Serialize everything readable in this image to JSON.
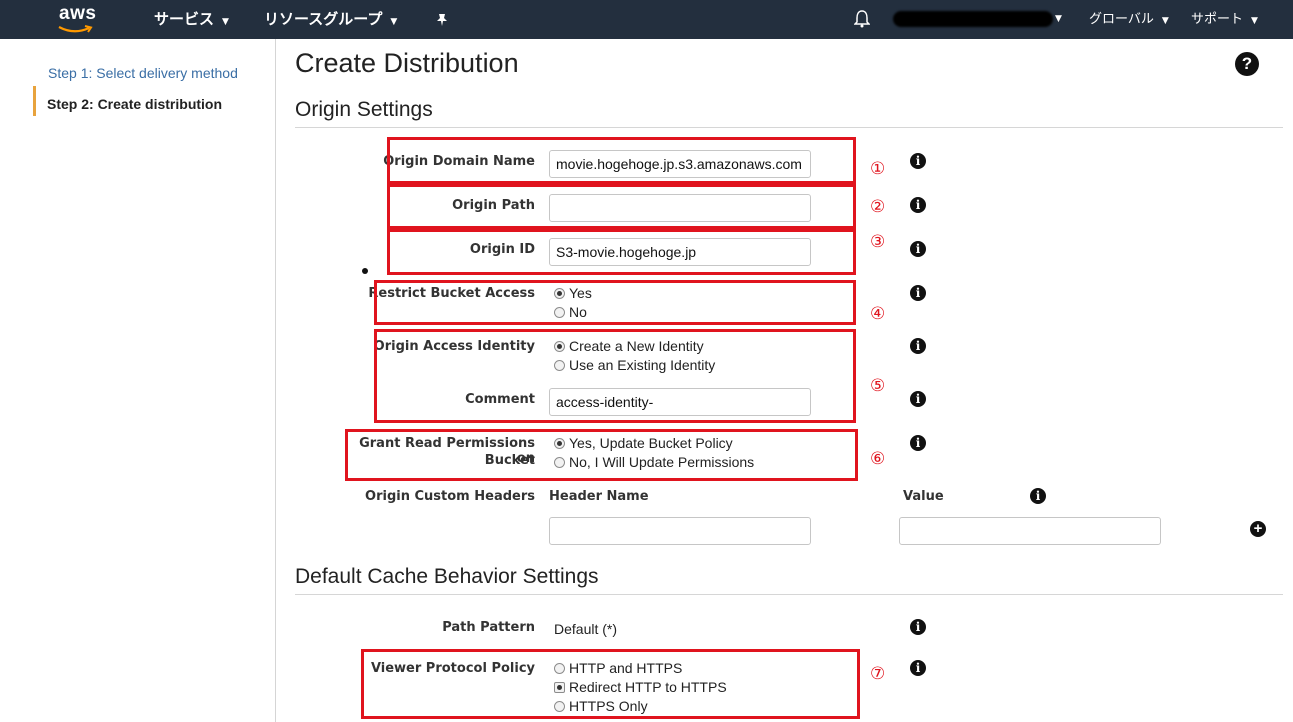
{
  "nav": {
    "logo_text": "aws",
    "services": "サービス",
    "resource_groups": "リソースグループ",
    "region": "グローバル",
    "support": "サポート"
  },
  "sidebar": {
    "step1": "Step 1: Select delivery method",
    "step2": "Step 2: Create distribution"
  },
  "page": {
    "title": "Create Distribution",
    "help_icon": "?",
    "origin_section": "Origin Settings",
    "cache_section": "Default Cache Behavior Settings"
  },
  "origin": {
    "domain_label": "Origin Domain Name",
    "domain_value": "movie.hogehoge.jp.s3.amazonaws.com",
    "path_label": "Origin Path",
    "path_value": "",
    "id_label": "Origin ID",
    "id_value": "S3-movie.hogehoge.jp",
    "restrict_label": "Restrict Bucket Access",
    "restrict_options": [
      "Yes",
      "No"
    ],
    "restrict_selected": "Yes",
    "oai_label": "Origin Access Identity",
    "oai_options": [
      "Create a New Identity",
      "Use an Existing Identity"
    ],
    "oai_selected": "Create a New Identity",
    "comment_label": "Comment",
    "comment_value": "access-identity-",
    "grant_label_1": "Grant Read Permissions on",
    "grant_label_2": "Bucket",
    "grant_options": [
      "Yes, Update Bucket Policy",
      "No, I Will Update Permissions"
    ],
    "grant_selected": "Yes, Update Bucket Policy",
    "custom_headers_label": "Origin Custom Headers",
    "header_name_col": "Header Name",
    "value_col": "Value"
  },
  "cache": {
    "path_pattern_label": "Path Pattern",
    "path_pattern_value": "Default (*)",
    "viewer_protocol_label": "Viewer Protocol Policy",
    "viewer_protocol_options": [
      "HTTP and HTTPS",
      "Redirect HTTP to HTTPS",
      "HTTPS Only"
    ],
    "viewer_protocol_selected": "Redirect HTTP to HTTPS"
  },
  "annotations": [
    "①",
    "②",
    "③",
    "④",
    "⑤",
    "⑥",
    "⑦"
  ],
  "icons": {
    "info": "i",
    "plus": "+"
  },
  "colors": {
    "nav_bg": "#232f3e",
    "highlight_red": "#e0141e",
    "step_accent": "#e8a33d",
    "link_blue": "#3a6ea5"
  }
}
